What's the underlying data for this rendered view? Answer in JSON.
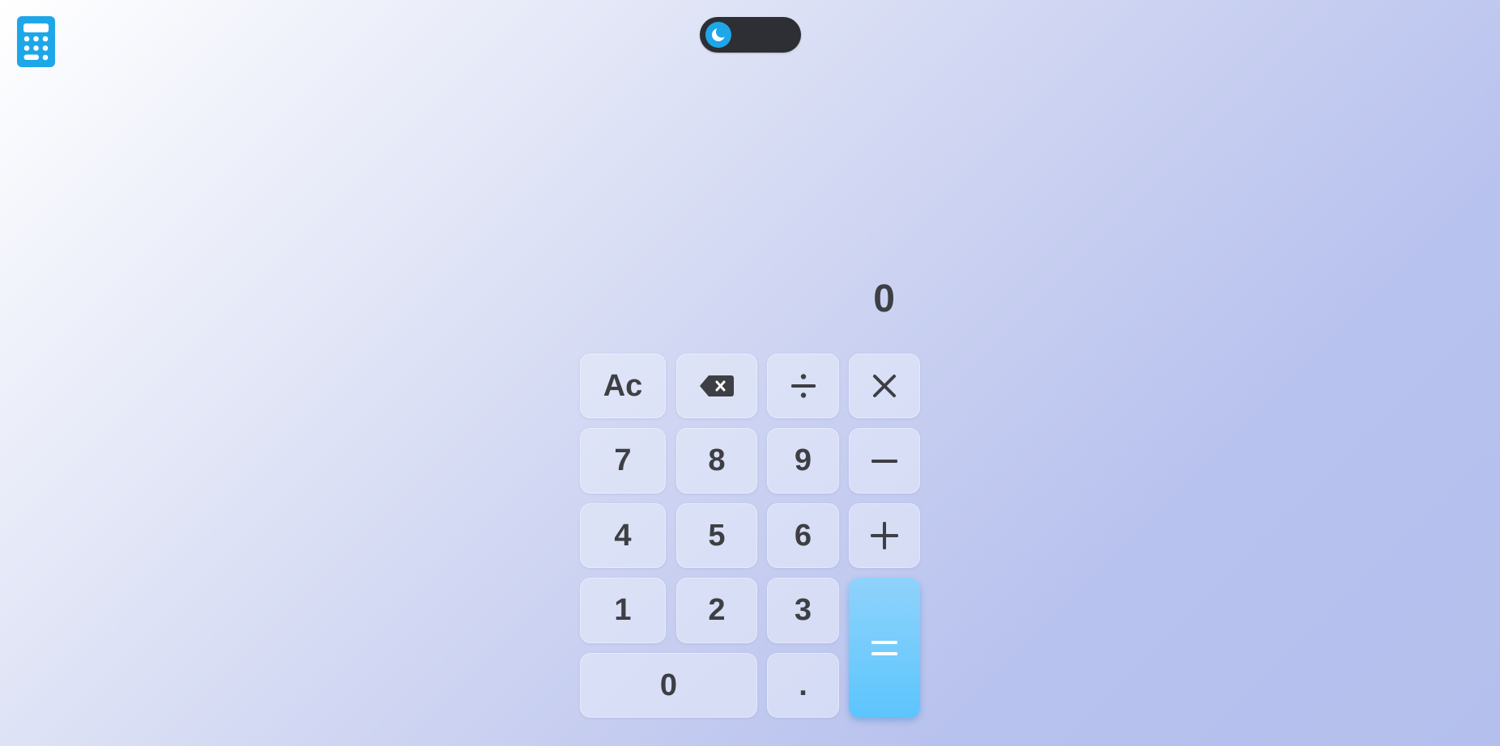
{
  "header": {
    "logo_icon": "calculator-icon",
    "theme_toggle": {
      "icon": "moon-icon",
      "mode": "dark",
      "accent": "#1ea7e8",
      "track_color": "#2d2f34"
    }
  },
  "display": {
    "value": "0"
  },
  "keypad": {
    "clear": "Ac",
    "backspace_icon": "backspace-icon",
    "divide_icon": "divide-icon",
    "multiply_icon": "multiply-icon",
    "minus_icon": "minus-icon",
    "plus_icon": "plus-icon",
    "equals_icon": "equals-icon",
    "seven": "7",
    "eight": "8",
    "nine": "9",
    "four": "4",
    "five": "5",
    "six": "6",
    "one": "1",
    "two": "2",
    "three": "3",
    "zero": "0",
    "decimal": "."
  },
  "colors": {
    "accent": "#1ea7e8",
    "equals_gradient_top": "#8fd3fb",
    "equals_gradient_bottom": "#5cc5fd",
    "text": "#3e3f44"
  }
}
